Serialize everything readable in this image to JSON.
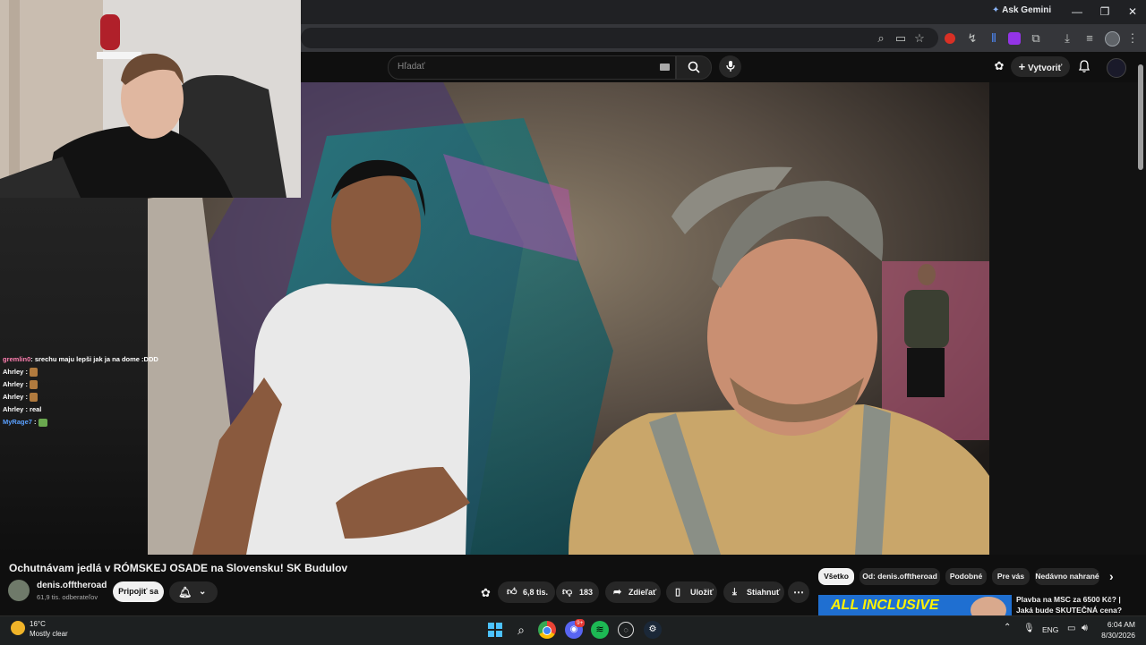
{
  "browser": {
    "ask_gemini": "Ask Gemini",
    "window_controls": [
      "—",
      "❐",
      "✕"
    ]
  },
  "youtube": {
    "search": {
      "placeholder": "Hľadať"
    },
    "create_label": "Vytvoriť",
    "video_title": "Ochutnávam jedlá v RÓMSKEJ OSADE na Slovensku! SK Budulov",
    "channel": {
      "name": "denis.offtheroad",
      "subscribers": "61,9 tis. odberateľov"
    },
    "join_label": "Pripojiť sa",
    "likes": "6,8 tis.",
    "dislikes": "183",
    "share_label": "Zdieľať",
    "save_label": "Uložiť",
    "download_label": "Stiahnuť",
    "chips": [
      "Všetko",
      "Od: denis.offtheroad",
      "Podobné",
      "Pre vás",
      "Nedávno nahrané"
    ],
    "recommended": {
      "thumb_text": "ALL INCLUSIVE",
      "title": "Plavba na MSC za 6500 Kč? | Jaká bude SKUTEČNÁ cena? |"
    }
  },
  "chat": [
    {
      "user": "gremlin0",
      "message": ": srechu maju lepši jak ja na dome :DDD",
      "color": "#ff7fb0"
    },
    {
      "user": "Ahrley",
      "message": ":",
      "emote": true,
      "color": "#ffffff"
    },
    {
      "user": "Ahrley",
      "message": ":",
      "emote": true,
      "color": "#ffffff"
    },
    {
      "user": "Ahrley",
      "message": ":",
      "emote": true,
      "color": "#ffffff"
    },
    {
      "user": "Ahrley",
      "message": ": real",
      "emote": false,
      "color": "#ffffff"
    },
    {
      "user": "MyRage7",
      "message": ":",
      "emote": true,
      "color": "#5aa0ff"
    }
  ],
  "taskbar": {
    "weather": {
      "temp": "16°C",
      "condition": "Mostly clear"
    },
    "language": "ENG",
    "time": "6:04 AM",
    "date": "8/30/2026",
    "notification_badge": "9+"
  },
  "colors": {
    "youtube_bg": "#0f0f0f",
    "chrome_bg": "#202124",
    "accent_blue": "#8ab4f8"
  }
}
